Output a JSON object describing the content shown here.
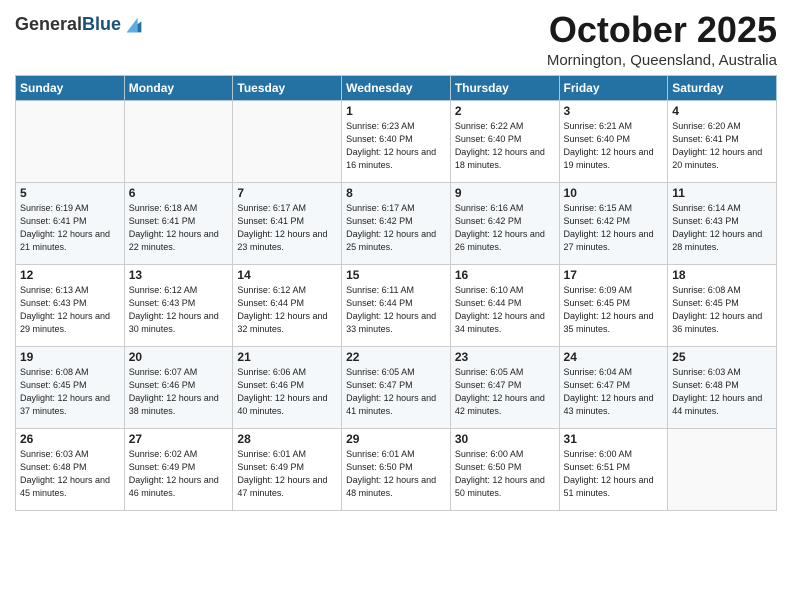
{
  "logo": {
    "general": "General",
    "blue": "Blue"
  },
  "header": {
    "month": "October 2025",
    "location": "Mornington, Queensland, Australia"
  },
  "weekdays": [
    "Sunday",
    "Monday",
    "Tuesday",
    "Wednesday",
    "Thursday",
    "Friday",
    "Saturday"
  ],
  "weeks": [
    [
      {
        "day": "",
        "sunrise": "",
        "sunset": "",
        "daylight": ""
      },
      {
        "day": "",
        "sunrise": "",
        "sunset": "",
        "daylight": ""
      },
      {
        "day": "",
        "sunrise": "",
        "sunset": "",
        "daylight": ""
      },
      {
        "day": "1",
        "sunrise": "6:23 AM",
        "sunset": "6:40 PM",
        "daylight": "12 hours and 16 minutes."
      },
      {
        "day": "2",
        "sunrise": "6:22 AM",
        "sunset": "6:40 PM",
        "daylight": "12 hours and 18 minutes."
      },
      {
        "day": "3",
        "sunrise": "6:21 AM",
        "sunset": "6:40 PM",
        "daylight": "12 hours and 19 minutes."
      },
      {
        "day": "4",
        "sunrise": "6:20 AM",
        "sunset": "6:41 PM",
        "daylight": "12 hours and 20 minutes."
      }
    ],
    [
      {
        "day": "5",
        "sunrise": "6:19 AM",
        "sunset": "6:41 PM",
        "daylight": "12 hours and 21 minutes."
      },
      {
        "day": "6",
        "sunrise": "6:18 AM",
        "sunset": "6:41 PM",
        "daylight": "12 hours and 22 minutes."
      },
      {
        "day": "7",
        "sunrise": "6:17 AM",
        "sunset": "6:41 PM",
        "daylight": "12 hours and 23 minutes."
      },
      {
        "day": "8",
        "sunrise": "6:17 AM",
        "sunset": "6:42 PM",
        "daylight": "12 hours and 25 minutes."
      },
      {
        "day": "9",
        "sunrise": "6:16 AM",
        "sunset": "6:42 PM",
        "daylight": "12 hours and 26 minutes."
      },
      {
        "day": "10",
        "sunrise": "6:15 AM",
        "sunset": "6:42 PM",
        "daylight": "12 hours and 27 minutes."
      },
      {
        "day": "11",
        "sunrise": "6:14 AM",
        "sunset": "6:43 PM",
        "daylight": "12 hours and 28 minutes."
      }
    ],
    [
      {
        "day": "12",
        "sunrise": "6:13 AM",
        "sunset": "6:43 PM",
        "daylight": "12 hours and 29 minutes."
      },
      {
        "day": "13",
        "sunrise": "6:12 AM",
        "sunset": "6:43 PM",
        "daylight": "12 hours and 30 minutes."
      },
      {
        "day": "14",
        "sunrise": "6:12 AM",
        "sunset": "6:44 PM",
        "daylight": "12 hours and 32 minutes."
      },
      {
        "day": "15",
        "sunrise": "6:11 AM",
        "sunset": "6:44 PM",
        "daylight": "12 hours and 33 minutes."
      },
      {
        "day": "16",
        "sunrise": "6:10 AM",
        "sunset": "6:44 PM",
        "daylight": "12 hours and 34 minutes."
      },
      {
        "day": "17",
        "sunrise": "6:09 AM",
        "sunset": "6:45 PM",
        "daylight": "12 hours and 35 minutes."
      },
      {
        "day": "18",
        "sunrise": "6:08 AM",
        "sunset": "6:45 PM",
        "daylight": "12 hours and 36 minutes."
      }
    ],
    [
      {
        "day": "19",
        "sunrise": "6:08 AM",
        "sunset": "6:45 PM",
        "daylight": "12 hours and 37 minutes."
      },
      {
        "day": "20",
        "sunrise": "6:07 AM",
        "sunset": "6:46 PM",
        "daylight": "12 hours and 38 minutes."
      },
      {
        "day": "21",
        "sunrise": "6:06 AM",
        "sunset": "6:46 PM",
        "daylight": "12 hours and 40 minutes."
      },
      {
        "day": "22",
        "sunrise": "6:05 AM",
        "sunset": "6:47 PM",
        "daylight": "12 hours and 41 minutes."
      },
      {
        "day": "23",
        "sunrise": "6:05 AM",
        "sunset": "6:47 PM",
        "daylight": "12 hours and 42 minutes."
      },
      {
        "day": "24",
        "sunrise": "6:04 AM",
        "sunset": "6:47 PM",
        "daylight": "12 hours and 43 minutes."
      },
      {
        "day": "25",
        "sunrise": "6:03 AM",
        "sunset": "6:48 PM",
        "daylight": "12 hours and 44 minutes."
      }
    ],
    [
      {
        "day": "26",
        "sunrise": "6:03 AM",
        "sunset": "6:48 PM",
        "daylight": "12 hours and 45 minutes."
      },
      {
        "day": "27",
        "sunrise": "6:02 AM",
        "sunset": "6:49 PM",
        "daylight": "12 hours and 46 minutes."
      },
      {
        "day": "28",
        "sunrise": "6:01 AM",
        "sunset": "6:49 PM",
        "daylight": "12 hours and 47 minutes."
      },
      {
        "day": "29",
        "sunrise": "6:01 AM",
        "sunset": "6:50 PM",
        "daylight": "12 hours and 48 minutes."
      },
      {
        "day": "30",
        "sunrise": "6:00 AM",
        "sunset": "6:50 PM",
        "daylight": "12 hours and 50 minutes."
      },
      {
        "day": "31",
        "sunrise": "6:00 AM",
        "sunset": "6:51 PM",
        "daylight": "12 hours and 51 minutes."
      },
      {
        "day": "",
        "sunrise": "",
        "sunset": "",
        "daylight": ""
      }
    ]
  ],
  "labels": {
    "sunrise": "Sunrise:",
    "sunset": "Sunset:",
    "daylight": "Daylight:"
  }
}
